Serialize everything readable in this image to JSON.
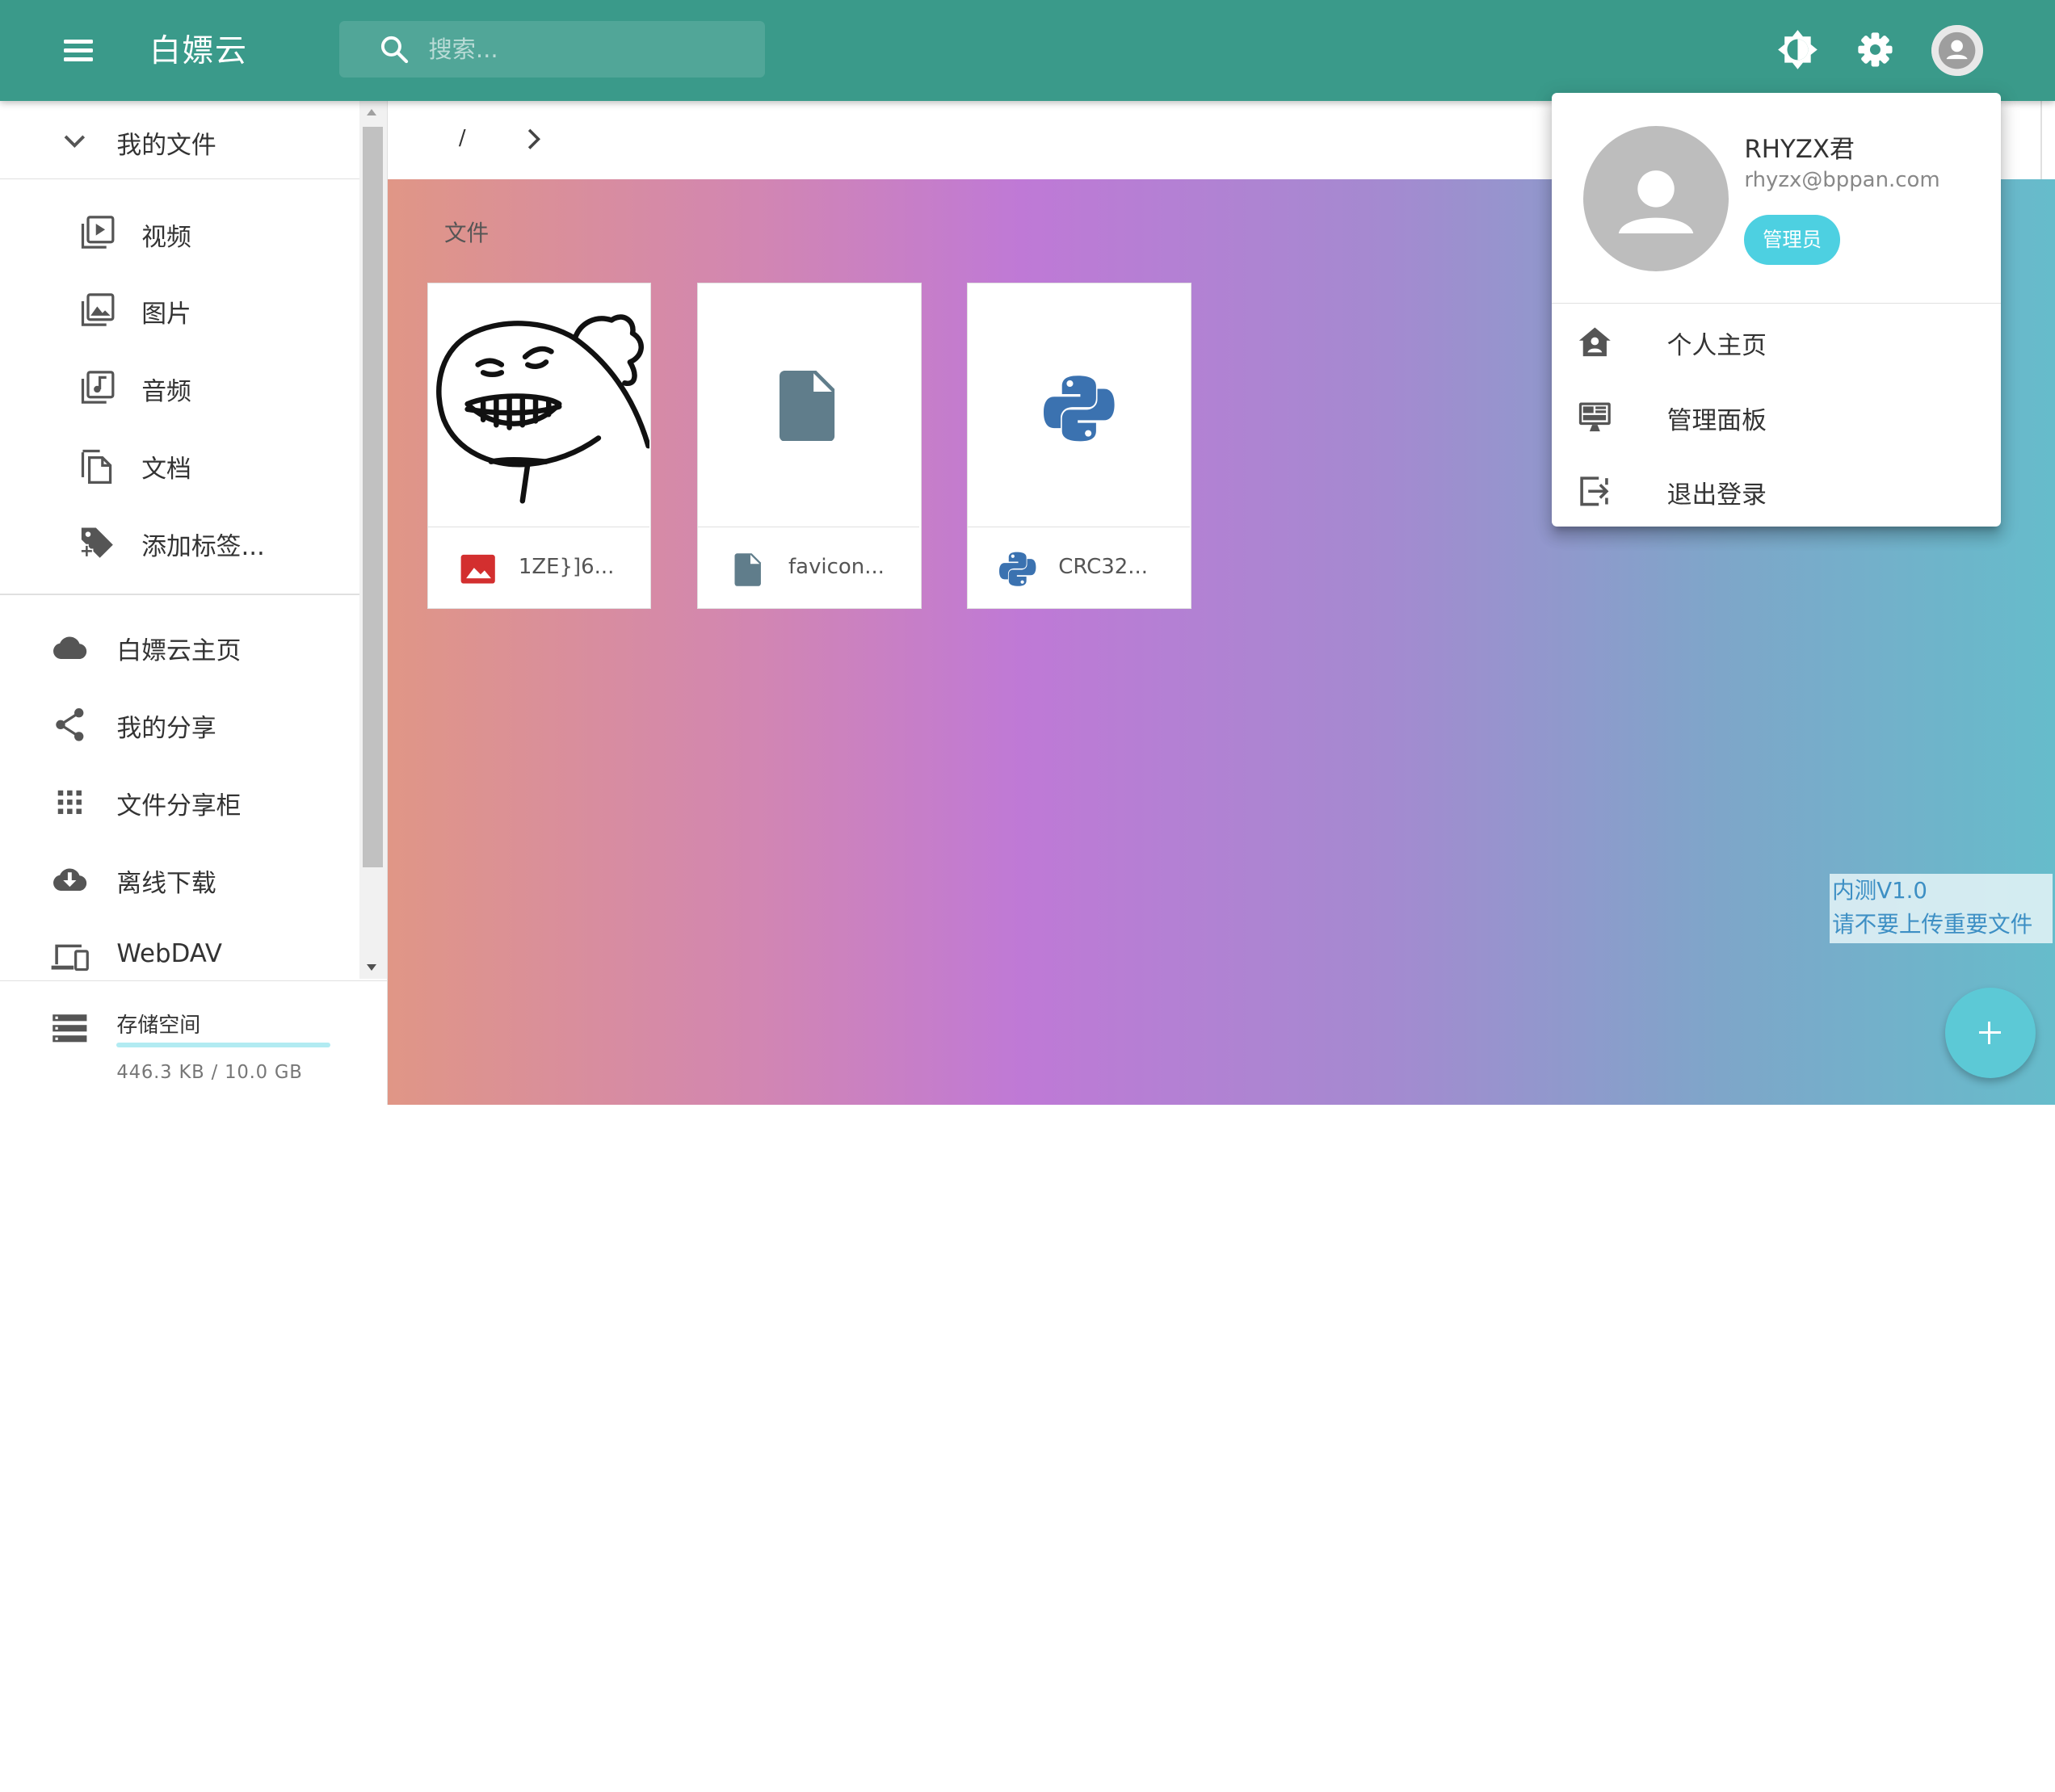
{
  "app": {
    "title": "白嫖云"
  },
  "search": {
    "placeholder": "搜索..."
  },
  "sidebar": {
    "my_files": "我的文件",
    "categories": [
      {
        "label": "视频",
        "icon": "video-library-icon"
      },
      {
        "label": "图片",
        "icon": "photo-library-icon"
      },
      {
        "label": "音频",
        "icon": "music-library-icon"
      },
      {
        "label": "文档",
        "icon": "file-copy-icon"
      },
      {
        "label": "添加标签...",
        "icon": "tag-plus-icon"
      }
    ],
    "nav": [
      {
        "label": "白嫖云主页",
        "icon": "cloud-icon"
      },
      {
        "label": "我的分享",
        "icon": "share-icon"
      },
      {
        "label": "文件分享柜",
        "icon": "apps-grid-icon"
      },
      {
        "label": "离线下载",
        "icon": "cloud-download-icon"
      },
      {
        "label": "WebDAV",
        "icon": "devices-icon"
      }
    ],
    "storage": {
      "label": "存储空间",
      "used_text": "446.3 KB / 10.0 GB",
      "used_fraction": 4e-05
    }
  },
  "breadcrumb": {
    "root": "/"
  },
  "main": {
    "section_title": "文件",
    "files": [
      {
        "name": "1ZE}]6...",
        "type": "image",
        "icon": "image-icon",
        "icon_color": "#d32f2f"
      },
      {
        "name": "favicon...",
        "type": "file",
        "icon": "file-icon",
        "icon_color": "#607d8b"
      },
      {
        "name": "CRC32...",
        "type": "python",
        "icon": "python-icon",
        "icon_color": "#3b72b0"
      }
    ]
  },
  "user_menu": {
    "name": "RHYZX君",
    "email": "rhyzx@bppan.com",
    "badge": "管理员",
    "items": [
      {
        "label": "个人主页",
        "icon": "home-account-icon"
      },
      {
        "label": "管理面板",
        "icon": "monitor-dashboard-icon"
      },
      {
        "label": "退出登录",
        "icon": "logout-icon"
      }
    ]
  },
  "notice": {
    "line1": "内测V1.0",
    "line2": "请不要上传重要文件"
  },
  "colors": {
    "primary": "#3a9a8a",
    "accent": "#4dd0e1"
  }
}
